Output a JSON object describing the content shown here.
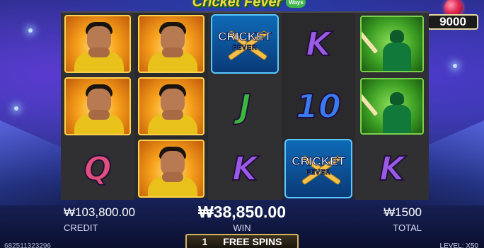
{
  "game": {
    "logo_text": "Cricket Fever",
    "logo_badge": "Ways"
  },
  "counter": {
    "icon": "cricket-ball-icon",
    "value": "9000"
  },
  "reels": [
    [
      {
        "type": "player-face"
      },
      {
        "type": "player-face"
      },
      {
        "type": "letter",
        "text": "Q",
        "color": "#e0507a"
      }
    ],
    [
      {
        "type": "player-face"
      },
      {
        "type": "player-face"
      },
      {
        "type": "player-face"
      }
    ],
    [
      {
        "type": "scatter",
        "title": "CRICKET",
        "subtitle": "FEVER"
      },
      {
        "type": "letter",
        "text": "J",
        "color": "#3ab83a"
      },
      {
        "type": "letter",
        "text": "K",
        "color": "#9a5ae6"
      }
    ],
    [
      {
        "type": "letter",
        "text": "K",
        "color": "#9a5ae6"
      },
      {
        "type": "letter",
        "text": "10",
        "color": "#3a7aef"
      },
      {
        "type": "scatter",
        "title": "CRICKET",
        "subtitle": "FEVER"
      }
    ],
    [
      {
        "type": "batsman"
      },
      {
        "type": "batsman"
      },
      {
        "type": "letter",
        "text": "K",
        "color": "#9a5ae6"
      }
    ]
  ],
  "footer": {
    "credit_value": "₩103,800.00",
    "credit_label": "CREDIT",
    "win_value": "₩38,850.00",
    "win_label": "WIN",
    "total_value": "₩1500",
    "total_label": "TOTAL",
    "free_spins_count": "1",
    "free_spins_label": "FREE SPINS",
    "session_id": "682511323296",
    "level_text": "LEVEL: X50"
  }
}
